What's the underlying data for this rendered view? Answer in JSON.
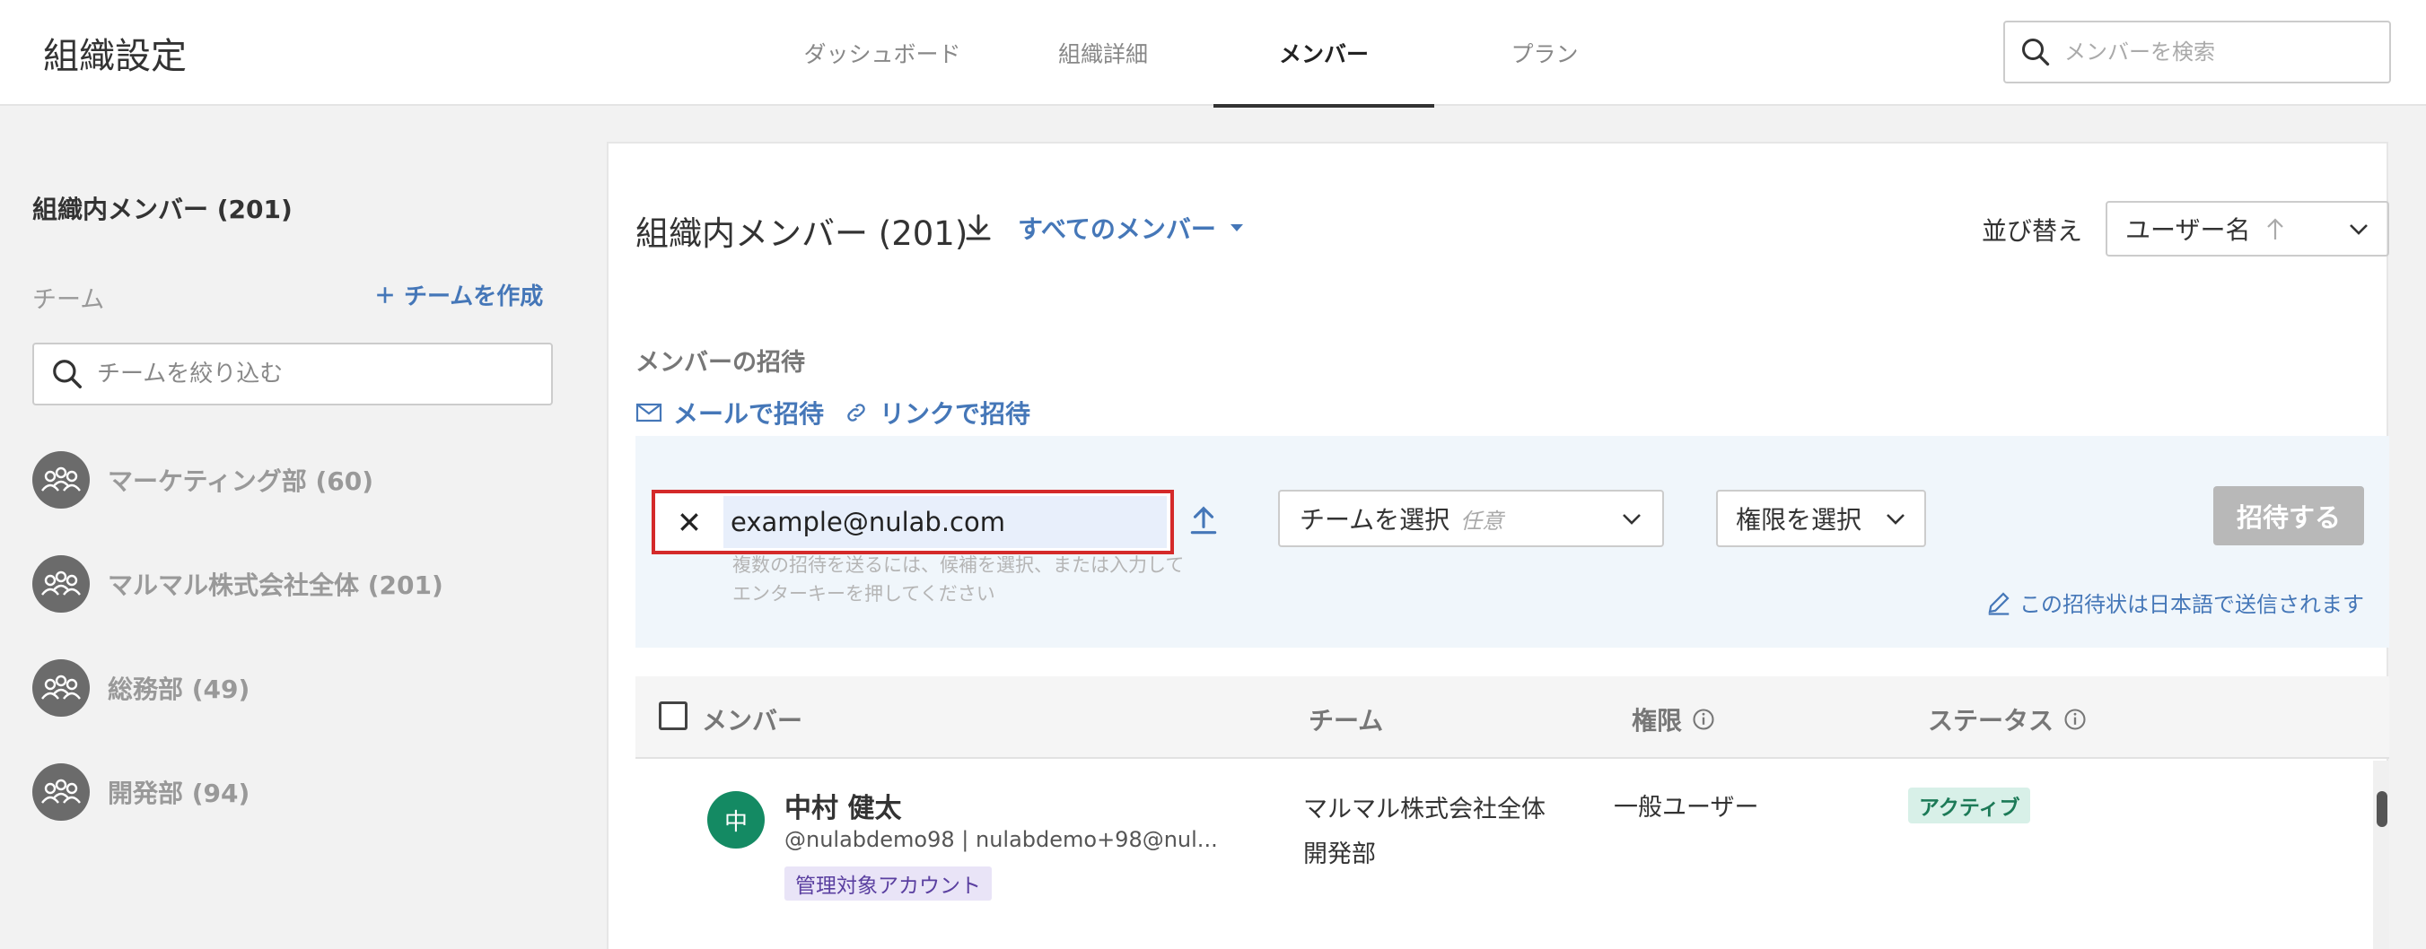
{
  "header": {
    "title": "組織設定",
    "tabs": [
      {
        "label": "ダッシュボード",
        "active": false
      },
      {
        "label": "組織詳細",
        "active": false
      },
      {
        "label": "メンバー",
        "active": true
      },
      {
        "label": "プラン",
        "active": false
      }
    ],
    "search_placeholder": "メンバーを検索"
  },
  "sidebar": {
    "title": "組織内メンバー (201)",
    "team_label": "チーム",
    "create_team": "チームを作成",
    "filter_placeholder": "チームを絞り込む",
    "teams": [
      {
        "name": "マーケティング部 (60)"
      },
      {
        "name": "マルマル株式会社全体 (201)"
      },
      {
        "name": "総務部 (49)"
      },
      {
        "name": "開発部 (94)"
      }
    ]
  },
  "main": {
    "title": "組織内メンバー (201)",
    "filter": "すべてのメンバー",
    "sort_label": "並び替え",
    "sort_value": "ユーザー名",
    "invite_label": "メンバーの招待",
    "invite_email": "メールで招待",
    "invite_link": "リンクで招待",
    "email_value": "example@nulab.com",
    "email_hint": "複数の招待を送るには、候補を選択、または入力してエンターキーを押してください",
    "team_select": "チームを選択",
    "team_select_optional": "任意",
    "perm_select": "権限を選択",
    "invite_button": "招待する",
    "lang_note": "この招待状は日本語で送信されます",
    "table": {
      "headers": {
        "member": "メンバー",
        "team": "チーム",
        "role": "権限",
        "status": "ステータス"
      },
      "rows": [
        {
          "avatar": "中",
          "name": "中村 健太",
          "sub": "@nulabdemo98 | nulabdemo+98@nul...",
          "badge": "管理対象アカウント",
          "team1": "マルマル株式会社全体",
          "team2": "開発部",
          "role": "一般ユーザー",
          "status": "アクティブ"
        }
      ]
    }
  },
  "colors": {
    "accent": "#4577b8",
    "avatar": "#148a63",
    "highlight": "#d42a2a"
  }
}
